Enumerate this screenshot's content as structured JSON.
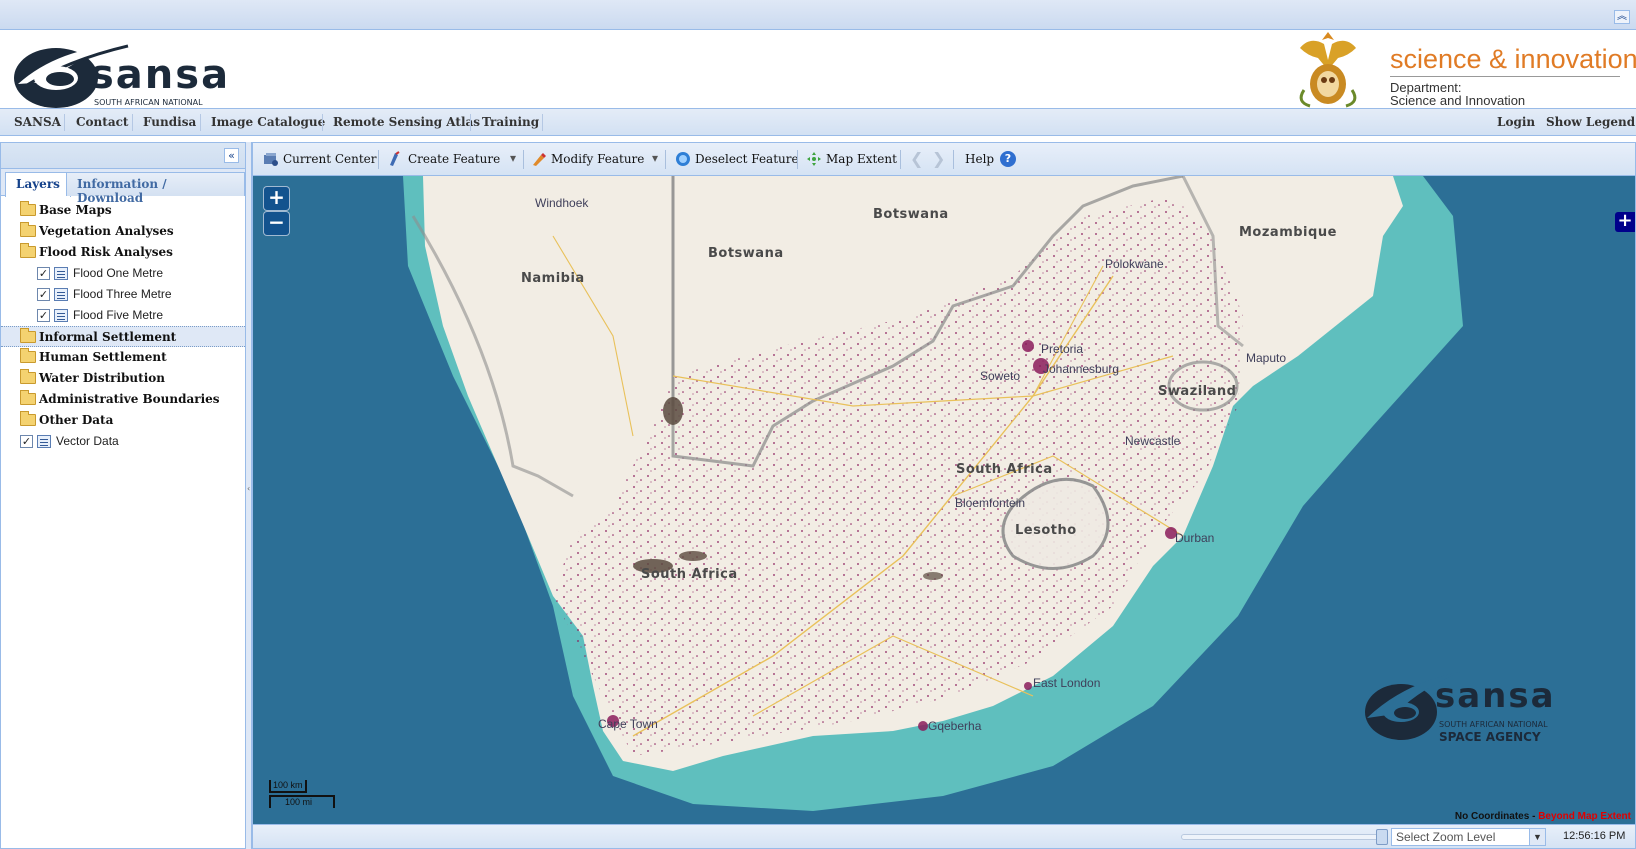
{
  "header": {
    "sansa_logo_text": "sansa",
    "sansa_logo_sub": "SOUTH AFRICAN NATIONAL",
    "dept_title": "science & innovation",
    "dept_line1": "Department:",
    "dept_line2": "Science and Innovation"
  },
  "nav": {
    "items": [
      "SANSA",
      "Contact",
      "Fundisa",
      "Image Catalogue",
      "Remote Sensing Atlas",
      "Training"
    ],
    "login": "Login",
    "show_legend": "Show Legend"
  },
  "left_panel": {
    "tabs": [
      "Layers",
      "Information / Download"
    ],
    "tree": [
      {
        "label": "Base Maps"
      },
      {
        "label": "Vegetation Analyses"
      },
      {
        "label": "Flood Risk Analyses"
      },
      {
        "label": "Flood One Metre",
        "checked": true
      },
      {
        "label": "Flood Three Metre",
        "checked": true
      },
      {
        "label": "Flood Five Metre",
        "checked": true
      },
      {
        "label": "Informal Settlement",
        "selected": true
      },
      {
        "label": "Human Settlement"
      },
      {
        "label": "Water Distribution"
      },
      {
        "label": "Administrative Boundaries"
      },
      {
        "label": "Other Data"
      },
      {
        "label": "Vector Data",
        "checked": true
      }
    ]
  },
  "toolbar": {
    "current_center": "Current Center",
    "create_feature": "Create Feature",
    "modify_feature": "Modify Feature",
    "deselect_feature": "Deselect Feature",
    "map_extent": "Map Extent",
    "help": "Help"
  },
  "map": {
    "zoom_in": "+",
    "zoom_out": "−",
    "countries": [
      "Namibia",
      "Botswana",
      "Botswana",
      "Mozambique",
      "Swaziland",
      "South Africa",
      "South Africa",
      "Lesotho"
    ],
    "cities": [
      "Windhoek",
      "Polokwane",
      "Pretoria",
      "Johannesburg",
      "Soweto",
      "Maputo",
      "Newcastle",
      "Bloemfontein",
      "Durban",
      "East London",
      "Gqeberha",
      "Cape Town"
    ],
    "scale_km": "100 km",
    "scale_mi": "100 mi",
    "coords": "No Coordinates",
    "coords_sep": " - ",
    "coords_link": "Beyond Map Extent",
    "watermark_name": "sansa",
    "watermark_line1": "SOUTH AFRICAN NATIONAL",
    "watermark_line2": "SPACE AGENCY"
  },
  "status": {
    "zoom_select_placeholder": "Select Zoom Level",
    "time": "12:56:16 PM"
  },
  "colors": {
    "ocean": "#2c6f96",
    "shelf": "#5fbfbe",
    "land": "#f2ede4",
    "flood": "#8b1c5c",
    "accent": "#e07b25",
    "ext_panel": "#dfe8f6"
  }
}
